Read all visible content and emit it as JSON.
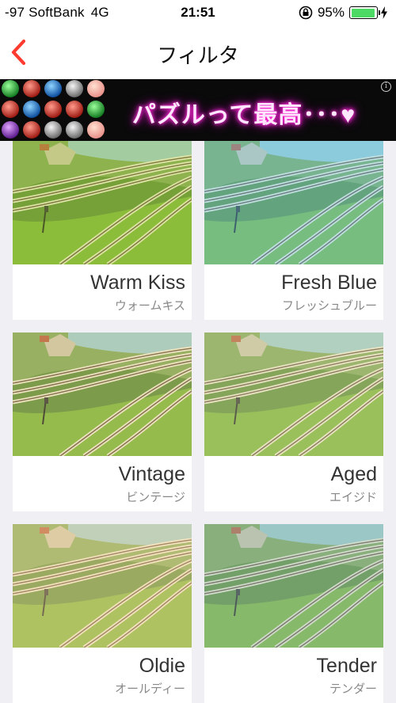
{
  "status_bar": {
    "carrier": "-97 SoftBank",
    "network": "4G",
    "time": "21:51",
    "battery_percent": "95%",
    "battery_level": 0.95
  },
  "nav": {
    "title": "フィルタ",
    "back_icon": "chevron-left-icon"
  },
  "ad": {
    "text": "パズルって最高･･･♥",
    "info_icon": "info-icon",
    "info_glyph": "i"
  },
  "filters": [
    {
      "name": "Warm Kiss",
      "kana": "ウォームキス",
      "tint": "#b8e03a",
      "tint_opacity": 0.28
    },
    {
      "name": "Fresh Blue",
      "kana": "フレッシュブルー",
      "tint": "#6fd3ff",
      "tint_opacity": 0.35
    },
    {
      "name": "Vintage",
      "kana": "ビンテージ",
      "tint": "#f2e08a",
      "tint_opacity": 0.22
    },
    {
      "name": "Aged",
      "kana": "エイジド",
      "tint": "#e0e6a8",
      "tint_opacity": 0.3
    },
    {
      "name": "Oldie",
      "kana": "オールディー",
      "tint": "#ffe0a0",
      "tint_opacity": 0.38
    },
    {
      "name": "Tender",
      "kana": "テンダー",
      "tint": "#9ec9c2",
      "tint_opacity": 0.35
    }
  ]
}
